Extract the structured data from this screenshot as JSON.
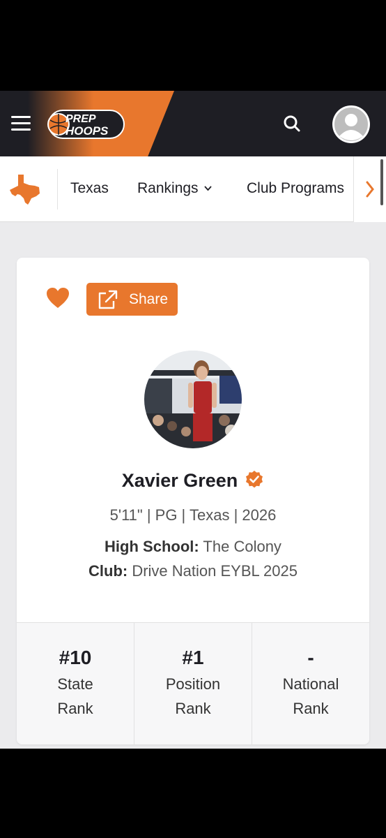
{
  "header": {
    "logo_line1": "PREP",
    "logo_line2": "HOOPS",
    "brand_color": "#e8772d",
    "icons": [
      "menu-icon",
      "search-icon",
      "user-avatar-icon"
    ]
  },
  "subnav": {
    "state_icon": "texas-state-icon",
    "items": [
      {
        "label": "Texas"
      },
      {
        "label": "Rankings"
      },
      {
        "label": "Club Programs"
      }
    ],
    "more_icon": "chevron-right-icon"
  },
  "profile": {
    "share_label": "Share",
    "name": "Xavier Green",
    "verified_icon": "verified-check-icon",
    "meta": "5'11\" | PG | Texas | 2026",
    "high_school_label": "High School:",
    "high_school": "The Colony",
    "club_label": "Club:",
    "club": "Drive Nation EYBL 2025"
  },
  "ranks": [
    {
      "value": "#10",
      "line1": "State",
      "line2": "Rank"
    },
    {
      "value": "#1",
      "line1": "Position",
      "line2": "Rank"
    },
    {
      "value": "-",
      "line1": "National",
      "line2": "Rank"
    }
  ]
}
